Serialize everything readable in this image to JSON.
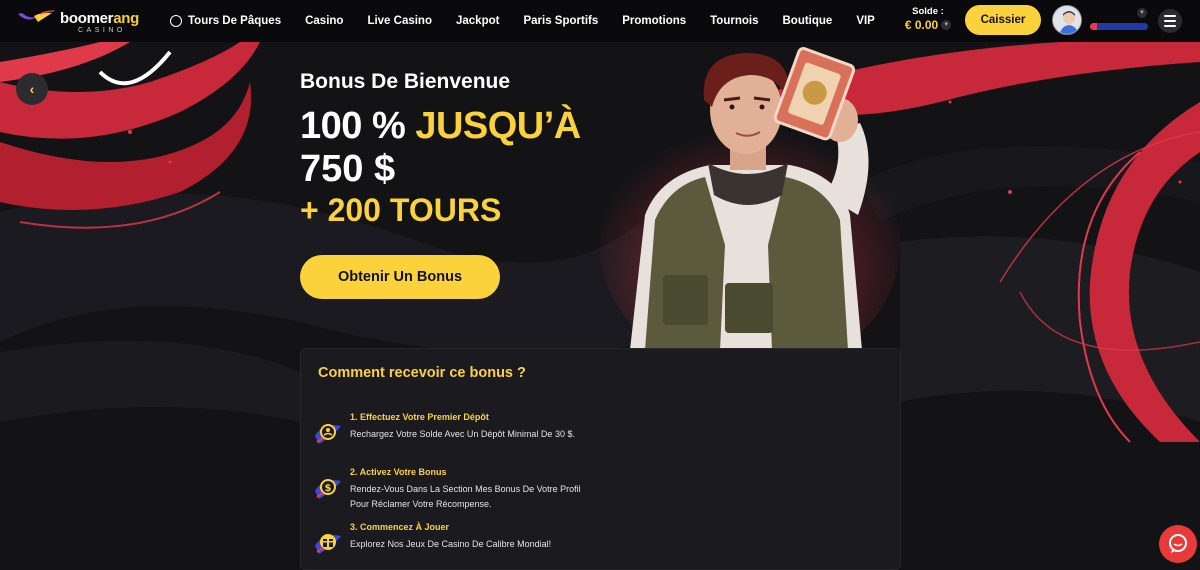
{
  "brand": {
    "name_part1": "boomer",
    "name_part2": "ang",
    "subtitle": "CASINO",
    "accent": "#fbd23c",
    "secondary": "#e83a47"
  },
  "nav": {
    "items": [
      {
        "label": "Tours De Pâques",
        "icon": "globe-icon"
      },
      {
        "label": "Casino"
      },
      {
        "label": "Live Casino"
      },
      {
        "label": "Jackpot"
      },
      {
        "label": "Paris Sportifs"
      },
      {
        "label": "Promotions"
      },
      {
        "label": "Tournois"
      },
      {
        "label": "Boutique"
      },
      {
        "label": "VIP"
      }
    ]
  },
  "account": {
    "balance_label": "Solde :",
    "balance_value": "€ 0.00",
    "cashier_label": "Caissier",
    "level_progress": 0.12
  },
  "hero": {
    "kicker": "Bonus De Bienvenue",
    "percent": "100 %",
    "upto": "JUSQU’À",
    "amount": "750 $",
    "spins": "+ 200 TOURS",
    "cta": "Obtenir Un Bonus"
  },
  "how": {
    "title": "Comment recevoir ce bonus ?",
    "steps": [
      {
        "title": "1. Effectuez Votre Premier Dépôt",
        "desc": "Rechargez Votre Solde Avec Un Dépôt Minimal De 30 $.",
        "icon": "user-coin-icon"
      },
      {
        "title": "2. Activez Votre Bonus",
        "desc": "Rendez-Vous Dans La Section Mes Bonus De Votre Profil Pour Réclamer Votre Récompense.",
        "icon": "dollar-coin-icon"
      },
      {
        "title": "3. Commencez À Jouer",
        "desc": "Explorez Nos Jeux De Casino De Calibre Mondial!",
        "icon": "gift-icon"
      }
    ]
  }
}
